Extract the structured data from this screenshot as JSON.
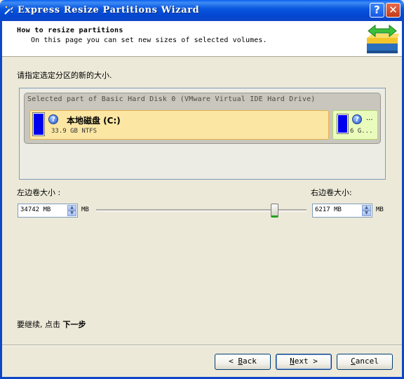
{
  "window": {
    "title": "Express Resize Partitions Wizard"
  },
  "header": {
    "title": "How to resize partitions",
    "subtitle": "On this page you can set new sizes of selected volumes."
  },
  "instruction": "请指定选定分区的新的大小.",
  "disk": {
    "label": "Selected part of Basic Hard Disk 0 (VMware Virtual IDE Hard Drive)",
    "partitions": [
      {
        "name": "本地磁盘  (C:)",
        "info": "33.9 GB NTFS"
      },
      {
        "name": "...",
        "info": "6 G..."
      }
    ]
  },
  "left_volume": {
    "label": "左边卷大小 :",
    "value": "34742 MB",
    "unit": "MB"
  },
  "right_volume": {
    "label": "右边卷大小:",
    "value": "6217 MB",
    "unit": "MB"
  },
  "slider": {
    "fraction": 0.848
  },
  "footer_text": {
    "prefix": "要继续, 点击 ",
    "action": "下一步"
  },
  "buttons": {
    "back": {
      "arrow": "<",
      "mnemonic": "B",
      "rest": "ack"
    },
    "next": {
      "mnemonic": "N",
      "rest": "ext",
      "arrow": ">"
    },
    "cancel": {
      "mnemonic": "C",
      "rest": "ancel"
    }
  },
  "title_buttons": {
    "help": "?",
    "close": "✕"
  },
  "colors": {
    "titlebar": "#0347d2",
    "volume_fill": "#0000ee",
    "partition_c": "#fbe6a4",
    "partition_d": "#eafcbc"
  },
  "icons": [
    "wizard-app-icon",
    "resize-arrows-logo",
    "help-icon"
  ]
}
